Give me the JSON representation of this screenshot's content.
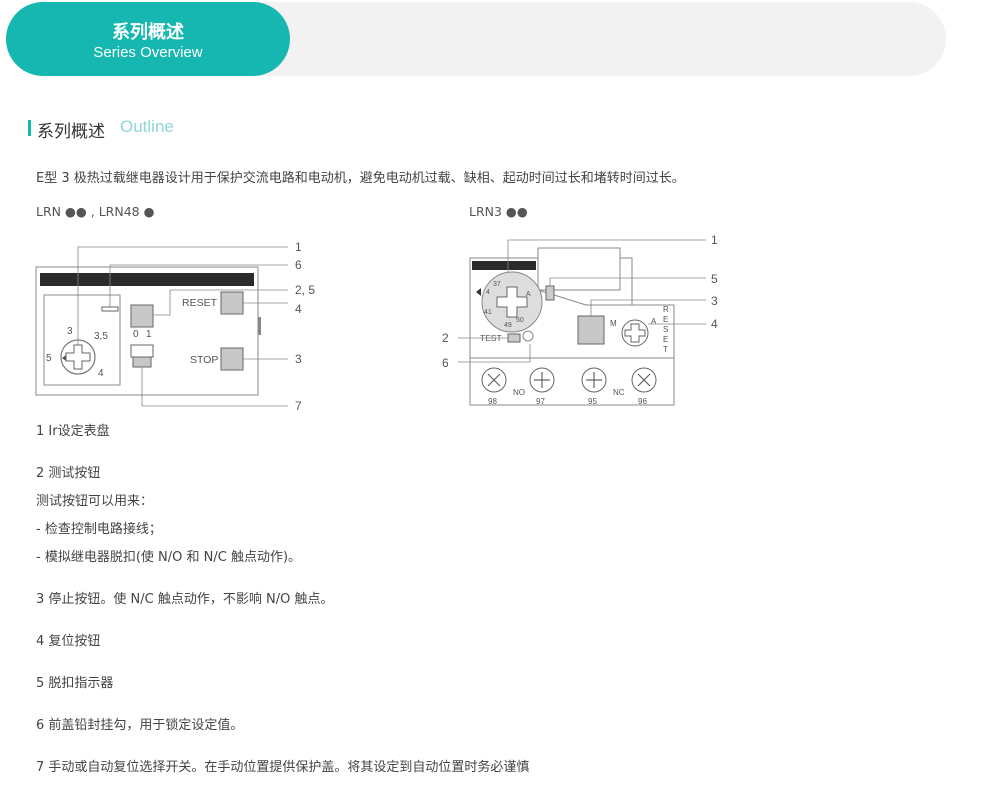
{
  "banner": {
    "title_cn": "系列概述",
    "title_en": "Series Overview"
  },
  "section": {
    "title_cn": "系列概述",
    "title_en": "Outline"
  },
  "intro": "E型 3 极热过载继电器设计用于保护交流电路和电动机，避免电动机过载、缺相、起动时间过长和堵转时间过长。",
  "figure_left": {
    "label": "LRN ●● , LRN48 ●",
    "callouts": {
      "c1": "1",
      "c6": "6",
      "c25": "2, 5",
      "c4": "4",
      "c3": "3",
      "c7": "7"
    },
    "reset_label": "RESET",
    "stop_label": "STOP",
    "dial": {
      "d3": "3",
      "d35": "3,5",
      "d5": "5",
      "d4": "4"
    },
    "switch": {
      "zero": "0",
      "one": "1"
    }
  },
  "figure_right": {
    "label": "LRN3 ●●",
    "callouts": {
      "c1": "1",
      "c5": "5",
      "c3": "3",
      "c4": "4",
      "c2": "2",
      "c6": "6"
    },
    "test_label": "TEST",
    "m_label": "M",
    "a_label": "A",
    "reset_letters": [
      "R",
      "E",
      "S",
      "E",
      "T"
    ],
    "dial": {
      "d37": "37",
      "d4": "4",
      "d41": "41",
      "d49": "49",
      "d50": "50"
    },
    "terminals": {
      "t98": "98",
      "no": "NO",
      "t97": "97",
      "t95": "95",
      "nc": "NC",
      "t96": "96"
    }
  },
  "descriptions": [
    "1 Ir设定表盘",
    "2 测试按钮",
    "测试按钮可以用来：",
    "- 检查控制电路接线；",
    "- 模拟继电器脱扣(使 N/O 和 N/C 触点动作)。",
    "3 停止按钮。使 N/C 触点动作，不影响 N/O 触点。",
    "4 复位按钮",
    "5 脱扣指示器",
    "6 前盖铅封挂勾，用于锁定设定值。",
    "7 手动或自动复位选择开关。在手动位置提供保护盖。将其设定到自动位置时务必谨慎"
  ],
  "colors": {
    "accent": "#16b7b1",
    "banner_bg": "#f2f2f2",
    "outline_text": "#8fd5da"
  }
}
